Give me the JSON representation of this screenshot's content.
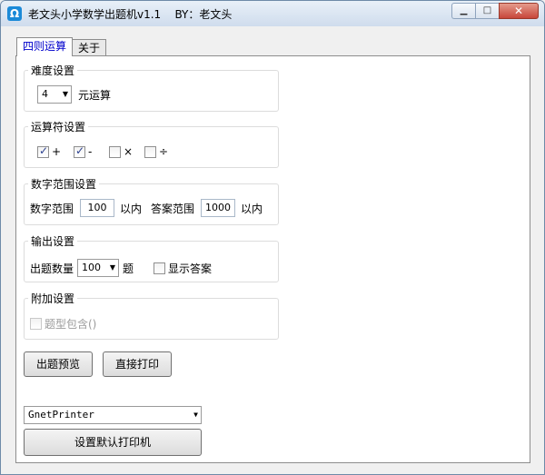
{
  "window": {
    "title": "老文头小学数学出题机v1.1    BY：老文头",
    "icon": "Ω",
    "controls": {
      "minimize": "▁",
      "maximize": "□",
      "close": "✕"
    }
  },
  "tabs": [
    {
      "label": "四则运算",
      "active": true
    },
    {
      "label": "关于",
      "active": false
    }
  ],
  "difficulty": {
    "title": "难度设置",
    "operand_count": "4",
    "suffix": "元运算"
  },
  "operators": {
    "title": "运算符设置",
    "items": [
      {
        "symbol": "+",
        "checked": true
      },
      {
        "symbol": "-",
        "checked": true
      },
      {
        "symbol": "×",
        "checked": false
      },
      {
        "symbol": "÷",
        "checked": false
      }
    ]
  },
  "range": {
    "title": "数字范围设置",
    "number_label": "数字范围",
    "number_value": "100",
    "number_suffix": "以内",
    "answer_label": "答案范围",
    "answer_value": "1000",
    "answer_suffix": "以内"
  },
  "output": {
    "title": "输出设置",
    "count_label": "出题数量",
    "count_value": "100",
    "count_suffix": "题",
    "show_answer_label": "显示答案",
    "show_answer_checked": false
  },
  "extra": {
    "title": "附加设置",
    "paren_label": "题型包含()",
    "paren_checked": false
  },
  "buttons": {
    "preview": "出题预览",
    "print": "直接打印"
  },
  "printer": {
    "selected": "GnetPrinter",
    "set_default": "设置默认打印机"
  }
}
